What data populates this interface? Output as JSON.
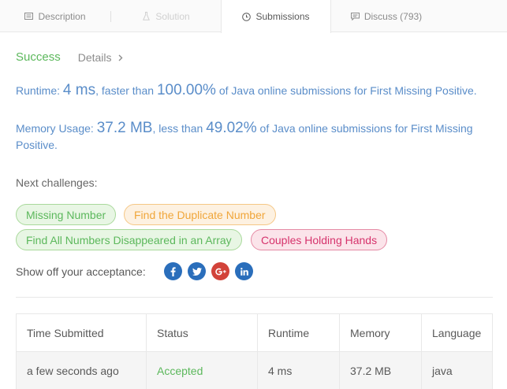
{
  "tabs": [
    {
      "label": "Description",
      "icon": "document-icon",
      "state": "normal"
    },
    {
      "label": "Solution",
      "icon": "flask-icon",
      "state": "disabled"
    },
    {
      "label": "Submissions",
      "icon": "clock-icon",
      "state": "active"
    },
    {
      "label": "Discuss (793)",
      "icon": "comment-icon",
      "state": "normal"
    }
  ],
  "result": {
    "status": "Success",
    "details_label": "Details"
  },
  "runtime": {
    "label": "Runtime:",
    "value": "4 ms",
    "compare": ", faster than",
    "percent": "100.00%",
    "suffix": "of Java online submissions for First Missing Positive."
  },
  "memory": {
    "label": "Memory Usage:",
    "value": "37.2 MB",
    "compare": ", less than",
    "percent": "49.02%",
    "suffix": "of Java online submissions for First Missing Positive."
  },
  "next": {
    "title": "Next challenges:",
    "challenges": [
      {
        "label": "Missing Number",
        "difficulty_color": "#5cb85c"
      },
      {
        "label": "Find the Duplicate Number",
        "difficulty_color": "#f0a63a"
      },
      {
        "label": "Find All Numbers Disappeared in an Array",
        "difficulty_color": "#5cb85c"
      },
      {
        "label": "Couples Holding Hands",
        "difficulty_color": "#d6336c"
      }
    ]
  },
  "share": {
    "label": "Show off your acceptance:",
    "networks": [
      "facebook-icon",
      "twitter-icon",
      "google-plus-icon",
      "linkedin-icon"
    ]
  },
  "table": {
    "headers": [
      "Time Submitted",
      "Status",
      "Runtime",
      "Memory",
      "Language"
    ],
    "rows": [
      [
        "a few seconds ago",
        "Accepted",
        "4 ms",
        "37.2 MB",
        "java"
      ]
    ]
  },
  "colors": {
    "success": "#5cb85c",
    "link_blue": "#5a8dc9",
    "social_blue": "#2a6ebb"
  }
}
